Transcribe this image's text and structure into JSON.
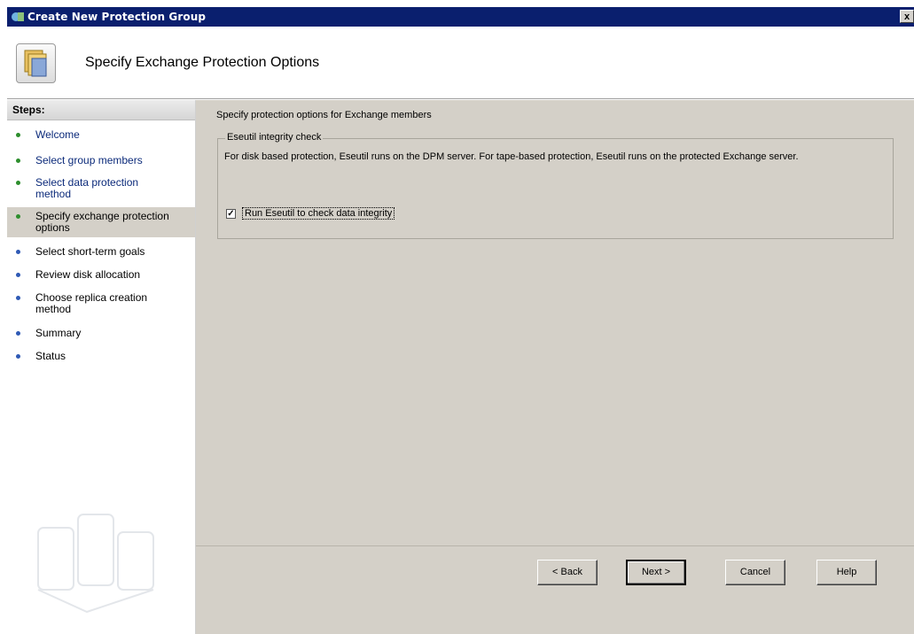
{
  "window": {
    "title": "Create New Protection Group",
    "close_label": "x"
  },
  "header": {
    "title": "Specify Exchange Protection Options"
  },
  "sidebar": {
    "header": "Steps:",
    "steps": [
      {
        "label": "Welcome",
        "state": "done"
      },
      {
        "label": "Select group members",
        "state": "done"
      },
      {
        "label": "Select data protection method",
        "state": "done"
      },
      {
        "label": "Specify exchange protection options",
        "state": "current"
      },
      {
        "label": "Select short-term goals",
        "state": "todo"
      },
      {
        "label": "Review disk allocation",
        "state": "todo"
      },
      {
        "label": "Choose replica creation method",
        "state": "todo"
      },
      {
        "label": "Summary",
        "state": "todo"
      },
      {
        "label": "Status",
        "state": "todo"
      }
    ]
  },
  "main": {
    "intro": "Specify protection options for Exchange members",
    "group": {
      "title": "Eseutil integrity check",
      "description": "For disk based protection, Eseutil runs on the DPM server. For tape-based protection, Eseutil runs on the protected Exchange server.",
      "checkbox_label": "Run Eseutil to check data integrity",
      "checked": true
    }
  },
  "buttons": {
    "back": "< Back",
    "next": "Next >",
    "cancel": "Cancel",
    "help": "Help"
  },
  "colors": {
    "titlebar": "#0a1f6e",
    "panel": "#d4d0c8",
    "link": "#0b2a7a",
    "done_dot": "#2d8e2d",
    "todo_dot": "#2f5ab5"
  }
}
